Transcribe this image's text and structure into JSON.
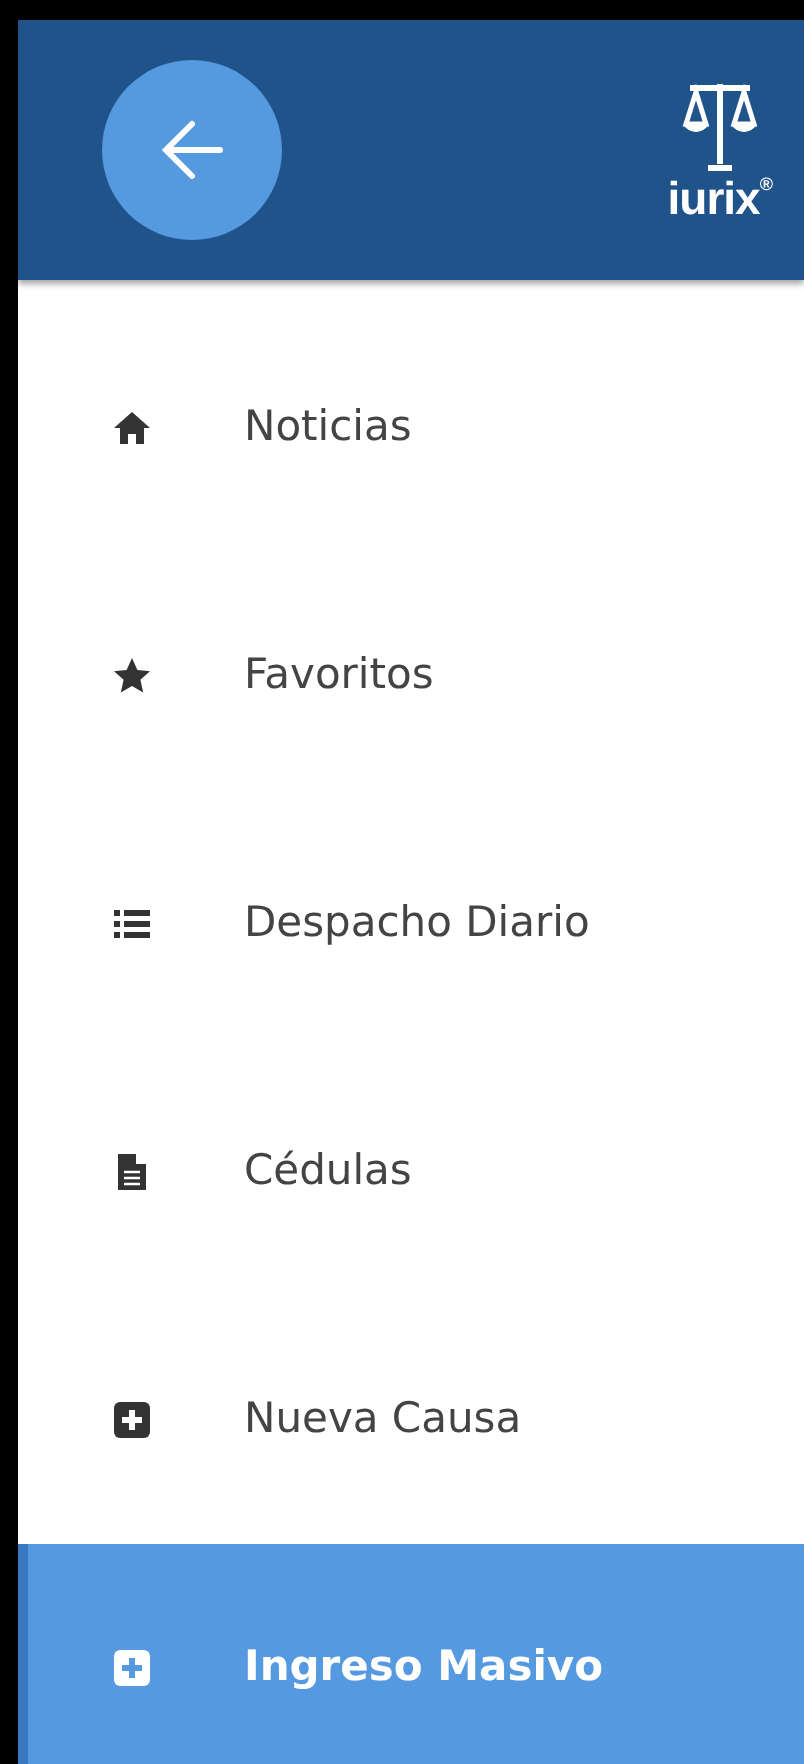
{
  "header": {
    "logo_text": "iurix",
    "logo_mark": "®"
  },
  "menu": [
    {
      "label": "Noticias",
      "selected": false
    },
    {
      "label": "Favoritos",
      "selected": false
    },
    {
      "label": "Despacho Diario",
      "selected": false
    },
    {
      "label": "Cédulas",
      "selected": false
    },
    {
      "label": "Nueva Causa",
      "selected": false
    },
    {
      "label": "Ingreso Masivo",
      "selected": true
    }
  ]
}
